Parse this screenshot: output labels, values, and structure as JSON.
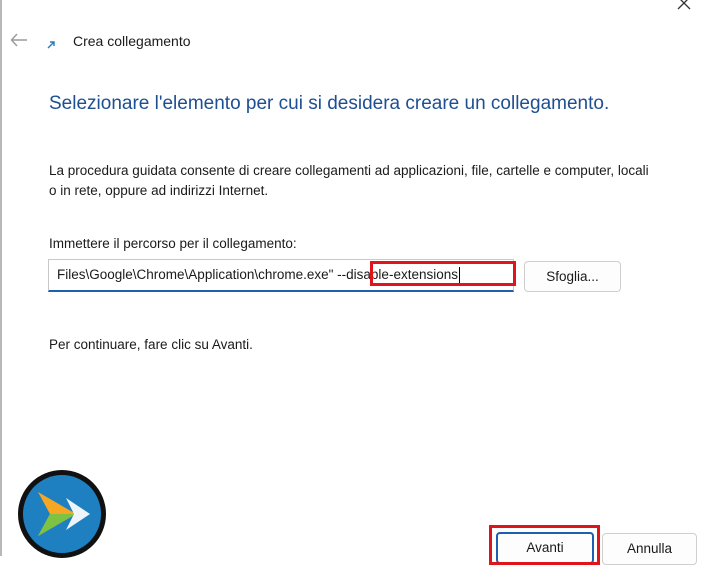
{
  "window": {
    "title": "Crea collegamento"
  },
  "page": {
    "heading": "Selezionare l'elemento per cui si desidera creare un collegamento.",
    "description": "La procedura guidata consente di creare collegamenti ad applicazioni, file, cartelle e computer, locali o in rete, oppure ad indirizzi Internet.",
    "field_label": "Immettere il percorso per il collegamento:",
    "path_value": "Files\\Google\\Chrome\\Application\\chrome.exe\" --disable-extensions",
    "browse_label": "Sfoglia...",
    "continue_hint": "Per continuare, fare clic su Avanti."
  },
  "footer": {
    "next_label": "Avanti",
    "cancel_label": "Annulla"
  },
  "icons": {
    "close": "close-icon",
    "back": "back-arrow-icon",
    "wizard": "shortcut-arrow-icon",
    "logo": "brand-logo"
  },
  "colors": {
    "heading": "#1d4f91",
    "input_focus": "#1d5fb0",
    "highlight": "#e0141b"
  }
}
